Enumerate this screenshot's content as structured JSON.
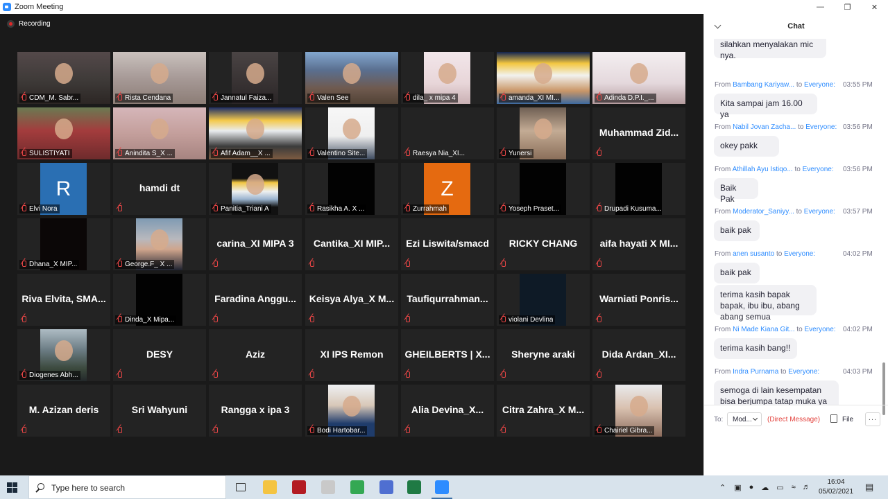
{
  "window": {
    "title": "Zoom Meeting"
  },
  "meeting": {
    "recording_label": "Recording"
  },
  "tiles": [
    {
      "name": "CDM_M. Sabr...",
      "kind": "video",
      "style": "v-room"
    },
    {
      "name": "Rista Cendana",
      "kind": "video",
      "style": "v-room2"
    },
    {
      "name": "Jannatul Faiza...",
      "kind": "video",
      "style": "v-dark"
    },
    {
      "name": "Valen See",
      "kind": "video",
      "style": "v-crowd"
    },
    {
      "name": "dila_ x mipa 4",
      "kind": "video",
      "style": "v-pink"
    },
    {
      "name": "amanda_XI MI...",
      "kind": "video",
      "style": "v-frame"
    },
    {
      "name": "Adinda D.P.I._...",
      "kind": "video",
      "style": "v-white"
    },
    {
      "name": "SULISTIYATI",
      "kind": "video",
      "style": "v-red"
    },
    {
      "name": "Anindita S_X ...",
      "kind": "video",
      "style": "v-pinkroom"
    },
    {
      "name": "Afif Adam__X ...",
      "kind": "video",
      "style": "v-framehead"
    },
    {
      "name": "Valentino Site...",
      "kind": "video",
      "style": "v-white2"
    },
    {
      "name": "Raesya Nia_XI...",
      "kind": "empty"
    },
    {
      "name": "Yunersi",
      "kind": "video",
      "style": "v-brown"
    },
    {
      "name": "Muhammad Zid...",
      "kind": "text"
    },
    {
      "name": "Elvi Nora",
      "kind": "video",
      "style": "v-blue",
      "initial": "R"
    },
    {
      "name": "hamdi dt",
      "kind": "text"
    },
    {
      "name": "Panitia_Triani A",
      "kind": "video",
      "style": "v-frame2"
    },
    {
      "name": "Rasikha A. X ...",
      "kind": "video",
      "style": "v-black"
    },
    {
      "name": "Zurrahmah",
      "kind": "video",
      "style": "v-orange",
      "initial": "Z"
    },
    {
      "name": "Yoseph Praset...",
      "kind": "video",
      "style": "v-black"
    },
    {
      "name": "Drupadi Kusuma...",
      "kind": "video",
      "style": "v-black",
      "plain": true
    },
    {
      "name": "Dhana_X MIP...",
      "kind": "video",
      "style": "v-black2"
    },
    {
      "name": "George.F_ X ...",
      "kind": "video",
      "style": "v-sky"
    },
    {
      "name": "carina_XI MIPA 3",
      "kind": "text"
    },
    {
      "name": "Cantika_XI MIP...",
      "kind": "text"
    },
    {
      "name": "Ezi Liswita/smacd",
      "kind": "text"
    },
    {
      "name": "RICKY CHANG",
      "kind": "text"
    },
    {
      "name": "aifa hayati X MI...",
      "kind": "text"
    },
    {
      "name": "Riva Elvita, SMA...",
      "kind": "text"
    },
    {
      "name": "Dinda_X Mipa...",
      "kind": "video",
      "style": "v-black"
    },
    {
      "name": "Faradina Anggu...",
      "kind": "text"
    },
    {
      "name": "Keisya Alya_X M...",
      "kind": "text"
    },
    {
      "name": "Taufiqurrahman...",
      "kind": "text"
    },
    {
      "name": "violani Devlina",
      "kind": "video",
      "style": "v-navy"
    },
    {
      "name": "Warniati Ponris...",
      "kind": "text"
    },
    {
      "name": "Diogenes Abh...",
      "kind": "video",
      "style": "v-cloak"
    },
    {
      "name": "DESY",
      "kind": "text"
    },
    {
      "name": "Aziz",
      "kind": "text"
    },
    {
      "name": "XI IPS Remon",
      "kind": "text"
    },
    {
      "name": "GHEILBERTS | X...",
      "kind": "text"
    },
    {
      "name": "Sheryne araki",
      "kind": "text"
    },
    {
      "name": "Dida Ardan_XI...",
      "kind": "text"
    },
    {
      "name": "M. Azizan deris",
      "kind": "text"
    },
    {
      "name": "Sri Wahyuni",
      "kind": "text"
    },
    {
      "name": "Rangga x ipa 3",
      "kind": "text"
    },
    {
      "name": "Bodi Hartobar...",
      "kind": "video",
      "style": "v-man"
    },
    {
      "name": "Alia Devina_X...",
      "kind": "text"
    },
    {
      "name": "Citra Zahra_X M...",
      "kind": "text"
    },
    {
      "name": "Chairiel Gibra...",
      "kind": "video",
      "style": "v-bald"
    }
  ],
  "chat": {
    "title": "Chat",
    "from_word": "From",
    "to_word": "to",
    "partial_top": {
      "line1": "silahkan menyalakan mic",
      "line2": "nya."
    },
    "messages": [
      {
        "sender": "Bambang Kariyaw...",
        "recipient": "Everyone:",
        "time": "03:55 PM",
        "texts": [
          "Kita sampai jam 16.00 ya"
        ]
      },
      {
        "sender": "Nabil Jovan Zacha...",
        "recipient": "Everyone:",
        "time": "03:56 PM",
        "texts": [
          "okey pakk"
        ]
      },
      {
        "sender": "Athillah Ayu Istiqo...",
        "recipient": "Everyone:",
        "time": "03:56 PM",
        "texts": [
          "Baik Pak"
        ]
      },
      {
        "sender": "Moderator_Saniyy...",
        "recipient": "Everyone:",
        "time": "03:57 PM",
        "texts": [
          "baik pak"
        ]
      },
      {
        "sender": "anen susanto",
        "recipient": "Everyone:",
        "time": "04:02 PM",
        "texts": [
          "baik pak",
          "terima kasih bapak bapak, ibu ibu, abang abang semua"
        ]
      },
      {
        "sender": "Ni Made Kiana Git...",
        "recipient": "Everyone:",
        "time": "04:02 PM",
        "texts": [
          "terima kasih bang!!"
        ]
      },
      {
        "sender": "Indra Purnama",
        "recipient": "Everyone:",
        "time": "04:03 PM",
        "texts": [
          "semoga di lain kesempatan bisa berjumpa tatap muka ya"
        ]
      }
    ],
    "compose": {
      "to_label": "To:",
      "to_value": "Mod...",
      "direct_message": "(Direct Message)",
      "file_label": "File",
      "more_label": "..."
    }
  },
  "taskbar": {
    "search_placeholder": "Type here to search",
    "apps": [
      {
        "name": "task-view",
        "color": "#d8e3ec"
      },
      {
        "name": "file-explorer",
        "color": "#f4c442"
      },
      {
        "name": "app-red",
        "color": "#b31b22"
      },
      {
        "name": "app-art",
        "color": "#c9c9c9"
      },
      {
        "name": "chrome",
        "color": "#34a853"
      },
      {
        "name": "snip",
        "color": "#4f6fd1"
      },
      {
        "name": "excel",
        "color": "#1f7a44"
      },
      {
        "name": "zoom",
        "color": "#2d8cff"
      }
    ],
    "clock_time": "16:04",
    "clock_date": "05/02/2021"
  }
}
